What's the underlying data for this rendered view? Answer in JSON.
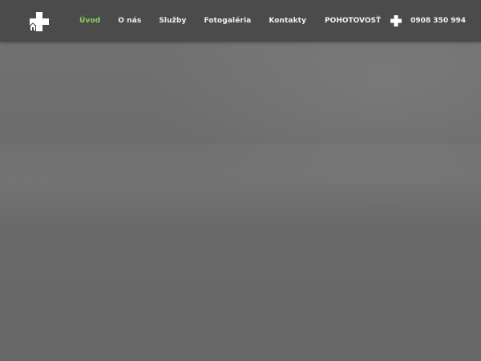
{
  "header": {
    "logo_icon": "house-medical-cross-icon",
    "nav": [
      {
        "label": "Úvod",
        "active": true
      },
      {
        "label": "O nás",
        "active": false
      },
      {
        "label": "Služby",
        "active": false
      },
      {
        "label": "Fotogaléria",
        "active": false
      },
      {
        "label": "Kontakty",
        "active": false
      }
    ],
    "emergency": {
      "label": "POHOTOVOSŤ",
      "icon": "medical-cross-icon",
      "phone": "0908 350 994"
    }
  },
  "colors": {
    "navbar_bg": "#4b4b4b",
    "active_link": "#8fcf5a",
    "link": "#f2f2f2",
    "hero_bg": "#6e6e6e"
  }
}
